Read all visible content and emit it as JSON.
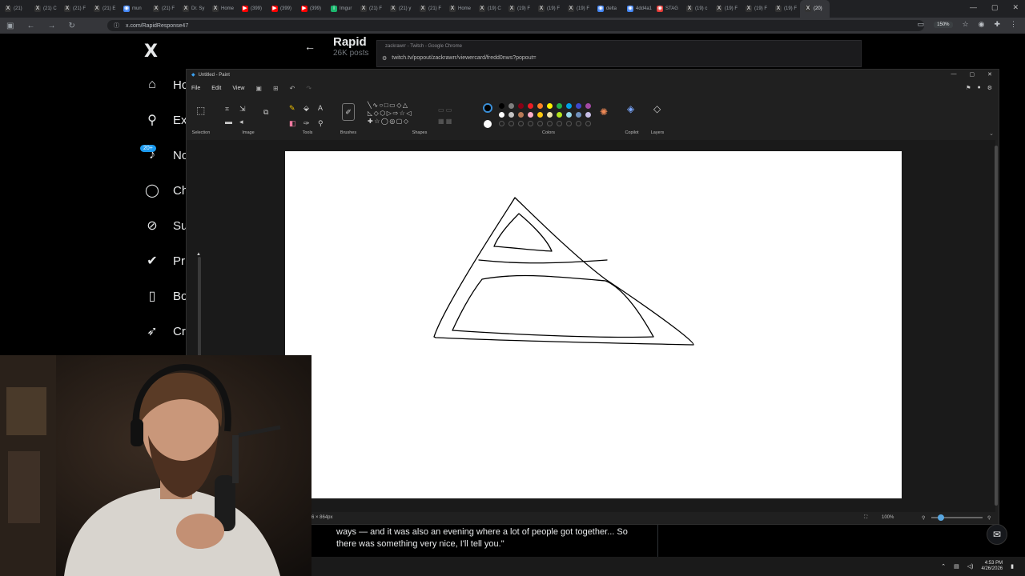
{
  "browser": {
    "tabs": [
      {
        "label": "(21) ",
        "icon": "x"
      },
      {
        "label": "(21) C",
        "icon": "x"
      },
      {
        "label": "(21) F",
        "icon": "x"
      },
      {
        "label": "(21) E",
        "icon": "x"
      },
      {
        "label": "mun",
        "icon": "globe"
      },
      {
        "label": "(21) F",
        "icon": "x"
      },
      {
        "label": "Dr. Sy",
        "icon": "x"
      },
      {
        "label": "Home",
        "icon": "x"
      },
      {
        "label": "(399)",
        "icon": "yt"
      },
      {
        "label": "(399)",
        "icon": "yt"
      },
      {
        "label": "(399)",
        "icon": "yt"
      },
      {
        "label": "Imgur",
        "icon": "imgur"
      },
      {
        "label": "(21) F",
        "icon": "x"
      },
      {
        "label": "(21) y",
        "icon": "x"
      },
      {
        "label": "(21) F",
        "icon": "x"
      },
      {
        "label": "Home",
        "icon": "x"
      },
      {
        "label": "(19) C",
        "icon": "x"
      },
      {
        "label": "(19) F",
        "icon": "x"
      },
      {
        "label": "(19) F",
        "icon": "x"
      },
      {
        "label": "(19) F",
        "icon": "x"
      },
      {
        "label": "delta",
        "icon": "globe"
      },
      {
        "label": "4dd4a14",
        "icon": "globe"
      },
      {
        "label": "STAG",
        "icon": "red"
      },
      {
        "label": "(19) c",
        "icon": "x"
      },
      {
        "label": "(19) F",
        "icon": "x"
      },
      {
        "label": "(19) F",
        "icon": "x"
      },
      {
        "label": "(19) F",
        "icon": "x"
      },
      {
        "label": "(20)",
        "icon": "x"
      }
    ],
    "url": "x.com/RapidResponse47",
    "zoom": "150%"
  },
  "x": {
    "nav": [
      {
        "label": "Ho",
        "icon": "home-icon",
        "glyph": "⌂"
      },
      {
        "label": "Ex",
        "icon": "search-icon",
        "glyph": "⚲"
      },
      {
        "label": "No",
        "icon": "bell-icon",
        "glyph": "♪"
      },
      {
        "label": "Ch",
        "icon": "chat-icon",
        "glyph": "◯"
      },
      {
        "label": "Su",
        "icon": "grok-icon",
        "glyph": "⊘"
      },
      {
        "label": "Pr",
        "icon": "verified-icon",
        "glyph": "✔"
      },
      {
        "label": "Bo",
        "icon": "bookmark-icon",
        "glyph": "▯"
      },
      {
        "label": "Cr",
        "icon": "rocket-icon",
        "glyph": "➶"
      }
    ],
    "notif_badge": "20+",
    "profile_name": "Rapid",
    "profile_posts": "26K posts",
    "tweet_text_line1": "ways — and it was also an evening where a lot of people got together... So",
    "tweet_text_line2": "there was something very nice, I'll tell you.\""
  },
  "twitch_popout": {
    "title": "zackrawrr - Twitch - Google Chrome",
    "url": "twitch.tv/popout/zackrawrr/viewercard/fredd0nws?popout="
  },
  "paint": {
    "window_title": "Untitled - Paint",
    "menu": [
      "File",
      "Edit",
      "View"
    ],
    "groups": [
      "Selection",
      "Image",
      "Tools",
      "Brushes",
      "Shapes",
      "Colors",
      "Copilot",
      "Layers"
    ],
    "colors": {
      "row1": [
        "#000000",
        "#7f7f7f",
        "#880015",
        "#ed1c24",
        "#ff7f27",
        "#fff200",
        "#22b14c",
        "#00a2e8",
        "#3f48cc",
        "#a349a4"
      ],
      "row2": [
        "#ffffff",
        "#c3c3c3",
        "#b97a57",
        "#ffaec9",
        "#ffc90e",
        "#efe4b0",
        "#b5e61d",
        "#99d9ea",
        "#7092be",
        "#c8bfe7"
      ],
      "primary": "#000000",
      "secondary": "#ffffff"
    },
    "canvas_size": "6 × 864px",
    "zoom": "100%"
  },
  "taskbar": {
    "time": "4:53 PM",
    "date": "4/26/2026"
  }
}
